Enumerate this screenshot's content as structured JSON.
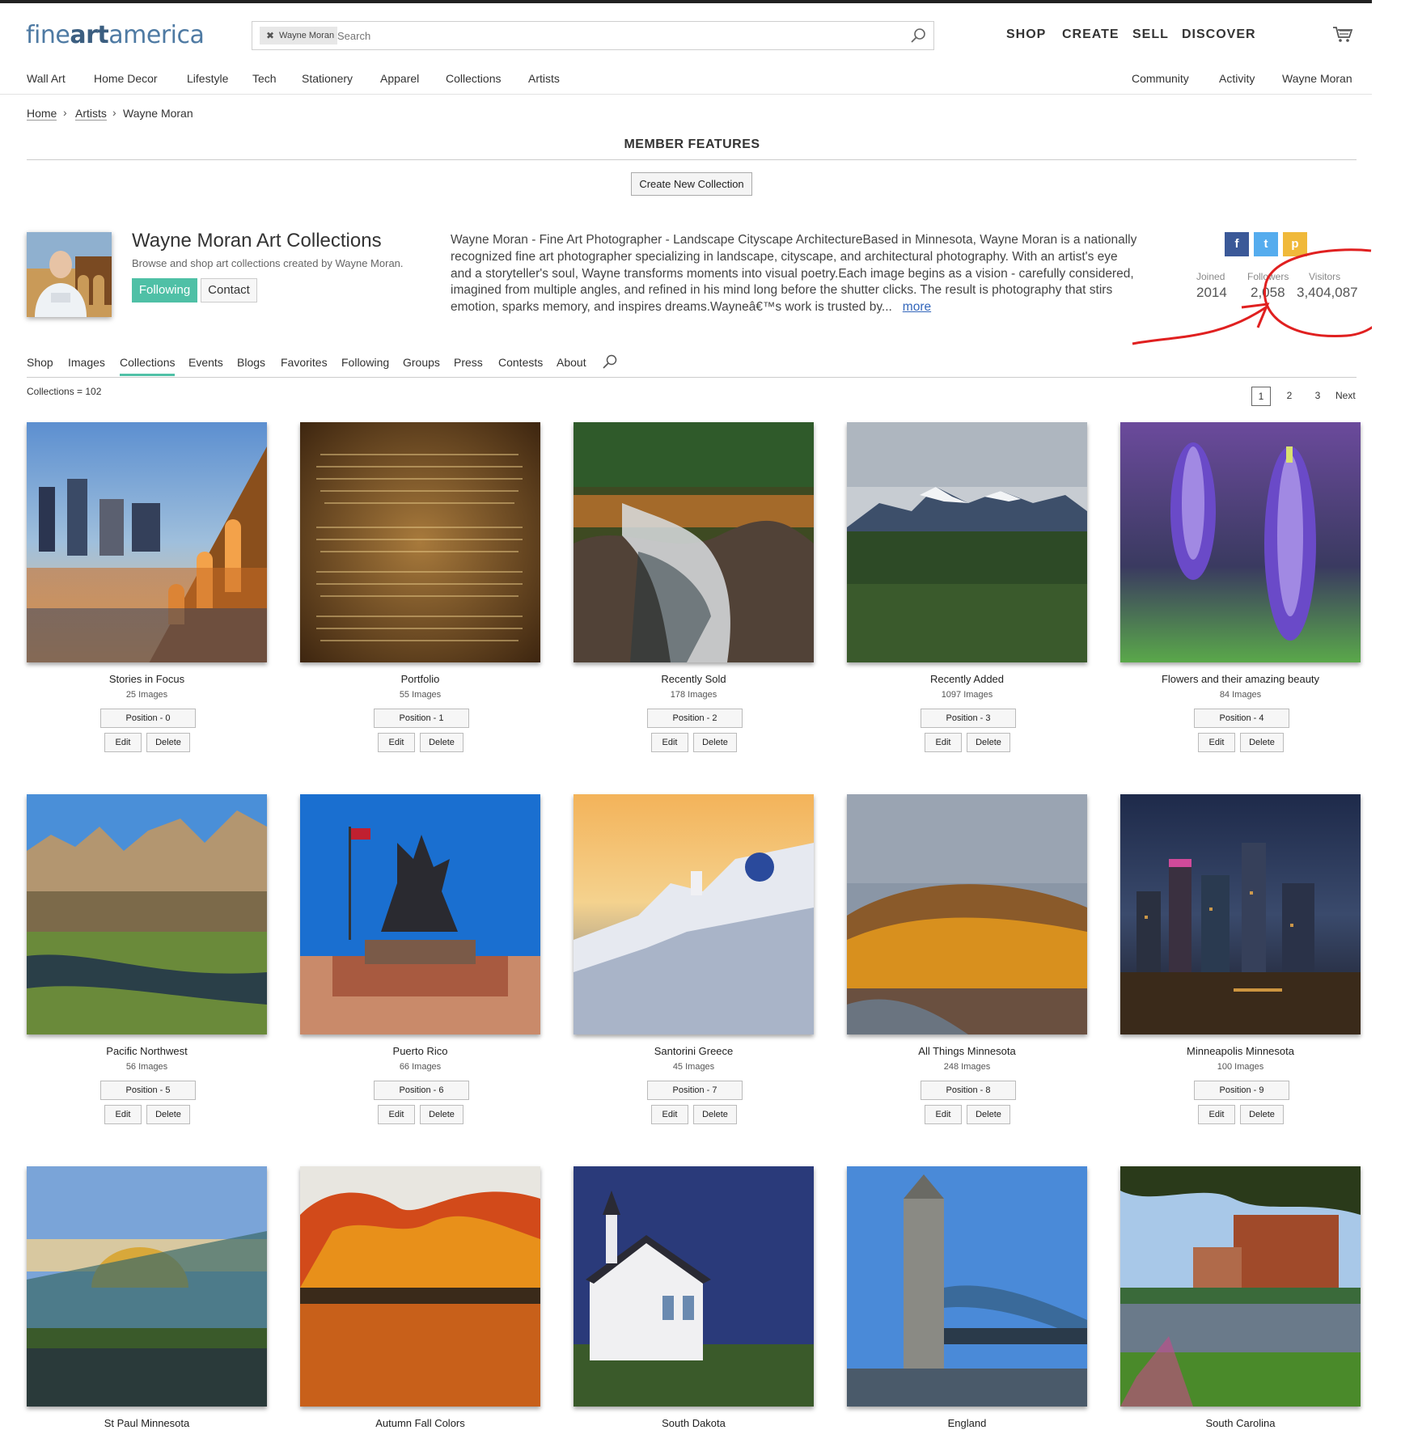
{
  "header": {
    "logo": {
      "part1": "fine",
      "part2": "art",
      "part3": "america"
    },
    "search": {
      "chip_label": "Wayne Moran",
      "placeholder": "Search"
    },
    "top_nav": [
      "SHOP",
      "CREATE",
      "SELL",
      "DISCOVER"
    ],
    "category_nav": [
      "Wall Art",
      "Home Decor",
      "Lifestyle",
      "Tech",
      "Stationery",
      "Apparel",
      "Collections",
      "Artists"
    ],
    "right_nav": [
      "Community",
      "Activity",
      "Wayne Moran"
    ]
  },
  "breadcrumb": [
    "Home",
    "Artists",
    "Wayne Moran"
  ],
  "section_title": "MEMBER FEATURES",
  "create_button": "Create New Collection",
  "profile": {
    "title": "Wayne Moran Art Collections",
    "subtitle": "Browse and shop art collections created by Wayne Moran.",
    "following_label": "Following",
    "contact_label": "Contact",
    "bio": "Wayne Moran - Fine Art Photographer - Landscape Cityscape ArchitectureBased in Minnesota, Wayne Moran is a nationally recognized fine art photographer specializing in landscape, cityscape, and architectural photography.   With an artist's eye and a storyteller's soul, Wayne transforms moments into visual poetry.Each image begins as a vision - carefully considered, imagined from multiple angles, and refined in his mind long before the shutter clicks.   The result is photography that stirs emotion, sparks memory, and inspires dreams.Wayneâ€™s work is trusted by...",
    "more_label": "more",
    "social": [
      {
        "icon": "facebook-icon",
        "glyph": "f",
        "color": "#3b5998"
      },
      {
        "icon": "twitter-icon",
        "glyph": "t",
        "color": "#55acee"
      },
      {
        "icon": "pinterest-icon",
        "glyph": "p",
        "color": "#f0b93a"
      }
    ],
    "stats": [
      {
        "label": "Joined",
        "value": "2014"
      },
      {
        "label": "Followers",
        "value": "2,058"
      },
      {
        "label": "Visitors",
        "value": "3,404,087"
      }
    ]
  },
  "annotation_color": "#e02020",
  "tabs": [
    "Shop",
    "Images",
    "Collections",
    "Events",
    "Blogs",
    "Favorites",
    "Following",
    "Groups",
    "Press",
    "Contests",
    "About"
  ],
  "active_tab": "Collections",
  "collections_count": "Collections = 102",
  "pagination": [
    "1",
    "2",
    "3"
  ],
  "pagination_next": "Next",
  "card_actions": {
    "edit": "Edit",
    "delete": "Delete"
  },
  "collections": [
    {
      "title": "Stories in Focus",
      "count": "25 Images",
      "position": "Position - 0"
    },
    {
      "title": "Portfolio",
      "count": "55 Images",
      "position": "Position - 1"
    },
    {
      "title": "Recently Sold",
      "count": "178 Images",
      "position": "Position - 2"
    },
    {
      "title": "Recently Added",
      "count": "1097 Images",
      "position": "Position - 3"
    },
    {
      "title": "Flowers and their amazing beauty",
      "count": "84 Images",
      "position": "Position - 4"
    },
    {
      "title": "Pacific Northwest",
      "count": "56 Images",
      "position": "Position - 5"
    },
    {
      "title": "Puerto Rico",
      "count": "66 Images",
      "position": "Position - 6"
    },
    {
      "title": "Santorini Greece",
      "count": "45 Images",
      "position": "Position - 7"
    },
    {
      "title": "All Things Minnesota",
      "count": "248 Images",
      "position": "Position - 8"
    },
    {
      "title": "Minneapolis Minnesota",
      "count": "100 Images",
      "position": "Position - 9"
    },
    {
      "title": "St Paul Minnesota",
      "count": "",
      "position": ""
    },
    {
      "title": "Autumn Fall Colors",
      "count": "",
      "position": ""
    },
    {
      "title": "South Dakota",
      "count": "",
      "position": ""
    },
    {
      "title": "England",
      "count": "",
      "position": ""
    },
    {
      "title": "South Carolina",
      "count": "",
      "position": ""
    }
  ]
}
